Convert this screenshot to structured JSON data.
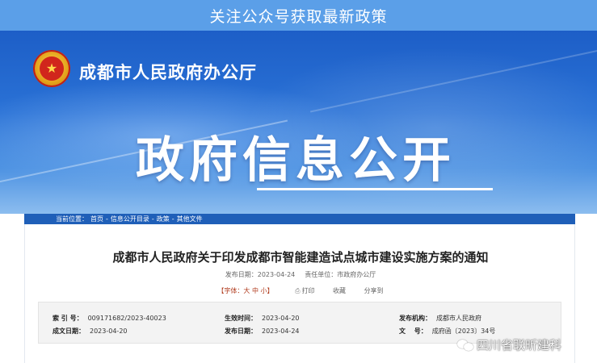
{
  "top_banner": {
    "text": "关注公众号获取最新政策"
  },
  "header": {
    "org_name": "成都市人民政府办公厅",
    "hero_title": "政府信息公开"
  },
  "breadcrumb": {
    "prefix": "当前位置：",
    "items": [
      "首页",
      "信息公开目录",
      "政策",
      "其他文件"
    ],
    "separator": "-"
  },
  "document": {
    "title": "成都市人民政府关于印发成都市智能建造试点城市建设实施方案的通知",
    "publish_date_label": "发布日期：",
    "publish_date": "2023-04-24",
    "unit_label": "责任单位：",
    "unit": "市政府办公厅"
  },
  "tools": {
    "font_size_label": "【字体：大 中 小】",
    "print": "打印",
    "favorite": "收藏",
    "share": "分享到"
  },
  "info": {
    "rows": [
      [
        {
          "label": "索 引 号：",
          "value": "009171682/2023-40023"
        },
        {
          "label": "生效时间：",
          "value": "2023-04-20"
        },
        {
          "label": "发布机构：",
          "value": "成都市人民政府"
        }
      ],
      [
        {
          "label": "成文日期：",
          "value": "2023-04-20"
        },
        {
          "label": "发布日期：",
          "value": "2023-04-24"
        },
        {
          "label": "文　 号：",
          "value": "成府函〔2023〕34号"
        }
      ]
    ]
  },
  "watermark": {
    "text": "四川省联昕建科"
  },
  "icons": {
    "emblem": "national-emblem-icon",
    "watermark": "wechat-icon"
  },
  "colors": {
    "top_banner": "#5b9fe8",
    "hero": "#2a72d6",
    "breadcrumb": "#1f5fb8"
  }
}
